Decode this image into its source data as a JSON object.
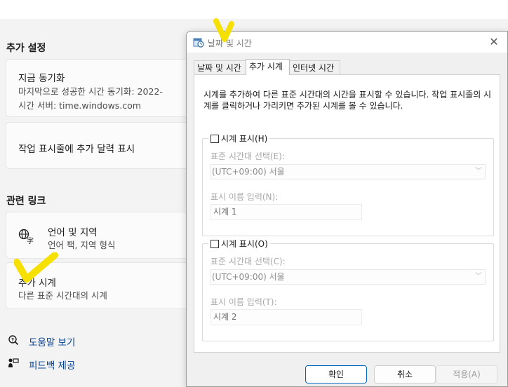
{
  "settings": {
    "section_additional": "추가 설정",
    "sync_title": "지금 동기화",
    "sync_last": "마지막으로 성공한 시간 동기화: 2022-",
    "sync_server": "시간 서버: time.windows.com",
    "taskbar_calendar": "작업 표시줄에 추가 달력 표시",
    "section_related": "관련 링크",
    "lang_title": "언어 및 지역",
    "lang_sub": "언어 팩, 지역 형식",
    "clocks_title": "추가 시계",
    "clocks_sub": "다른 표준 시간대의 시계",
    "help_link": "도움말 보기",
    "feedback_link": "피드백 제공"
  },
  "dialog": {
    "title": "날짜 및 시간",
    "tabs": [
      "날짜 및 시간",
      "추가 시계",
      "인터넷 시간"
    ],
    "description": "시계를 추가하여 다른 표준 시간대의 시간을 표시할 수 있습니다. 작업 표시줄의 시계를 클릭하거나 가리키면 추가된 시계를 볼 수 있습니다.",
    "clock1": {
      "checkbox_label": "시계 표시(H)",
      "tz_label": "표준 시간대 선택(E):",
      "tz_value": "(UTC+09:00) 서울",
      "name_label": "표시 이름 입력(N):",
      "name_value": "시계 1"
    },
    "clock2": {
      "checkbox_label": "시계 표시(O)",
      "tz_label": "표준 시간대 선택(C):",
      "tz_value": "(UTC+09:00) 서울",
      "name_label": "표시 이름 입력(T):",
      "name_value": "시계 2"
    },
    "buttons": {
      "ok": "확인",
      "cancel": "취소",
      "apply": "적용(A)"
    }
  },
  "colors": {
    "accent": "#0067c0",
    "link": "#003e92",
    "highlight": "#f5e000"
  },
  "icons": [
    "globe-language-icon",
    "help-icon",
    "feedback-icon",
    "close-icon",
    "clock-app-icon",
    "checkmark-highlight-icon"
  ]
}
